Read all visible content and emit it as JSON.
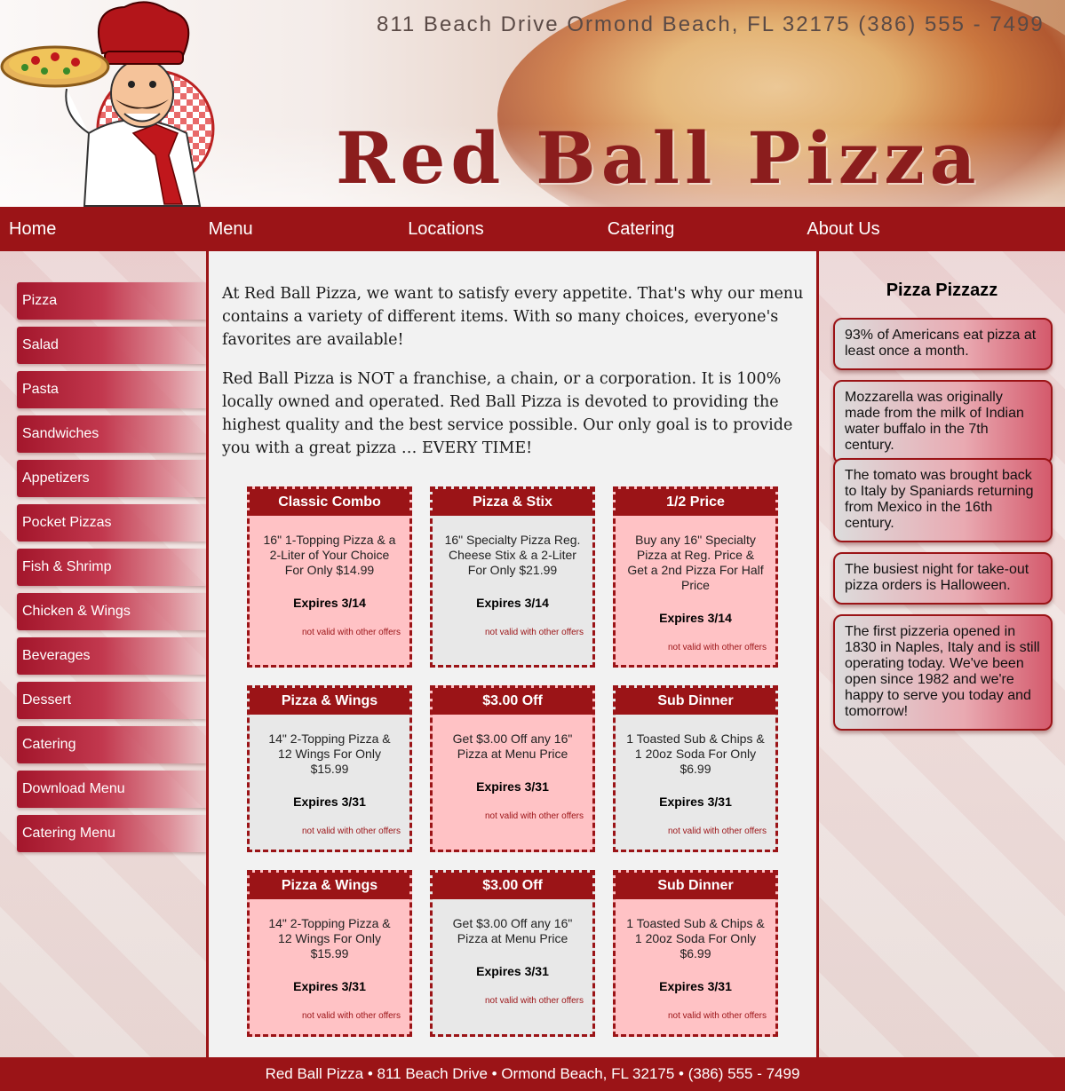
{
  "header": {
    "address_line": "811 Beach Drive  Ormond Beach, FL  32175   (386) 555 - 7499",
    "brand": "Red Ball Pizza"
  },
  "nav": [
    "Home",
    "Menu",
    "Locations",
    "Catering",
    "About Us"
  ],
  "sidebar": [
    "Pizza",
    "Salad",
    "Pasta",
    "Sandwiches",
    "Appetizers",
    "Pocket Pizzas",
    "Fish & Shrimp",
    "Chicken & Wings",
    "Beverages",
    "Dessert",
    "Catering",
    "Download Menu",
    "Catering Menu"
  ],
  "intro": [
    "At Red Ball Pizza, we want to satisfy every appetite. That's why our menu contains a variety of different items. With so many choices, everyone's favorites are available!",
    "Red Ball Pizza is NOT a franchise, a chain, or a corporation. It is 100% locally owned and operated. Red Ball Pizza is devoted to providing the highest quality and the best service possible. Our only goal is to provide you with a great pizza … EVERY TIME!"
  ],
  "coupons": [
    {
      "title": "Classic Combo",
      "desc": "16\" 1-Topping Pizza & a 2-Liter of Your Choice For Only $14.99",
      "expires": "Expires 3/14",
      "note": "not valid with other offers"
    },
    {
      "title": "Pizza & Stix",
      "desc": "16\" Specialty Pizza Reg. Cheese Stix & a 2-Liter For Only $21.99",
      "expires": "Expires 3/14",
      "note": "not valid with other offers"
    },
    {
      "title": "1/2 Price",
      "desc": "Buy any 16\" Specialty Pizza at Reg. Price & Get a 2nd Pizza For Half Price",
      "expires": "Expires 3/14",
      "note": "not valid with other offers"
    },
    {
      "title": "Pizza & Wings",
      "desc": "14\" 2-Topping Pizza & 12 Wings For Only $15.99",
      "expires": "Expires 3/31",
      "note": "not valid with other offers"
    },
    {
      "title": "$3.00 Off",
      "desc": "Get $3.00 Off any 16\" Pizza at Menu Price",
      "expires": "Expires 3/31",
      "note": "not valid with other offers"
    },
    {
      "title": "Sub Dinner",
      "desc": "1 Toasted Sub & Chips & 1 20oz Soda For Only $6.99",
      "expires": "Expires 3/31",
      "note": "not valid with other offers"
    },
    {
      "title": "Pizza & Wings",
      "desc": "14\" 2-Topping Pizza & 12 Wings For Only $15.99",
      "expires": "Expires 3/31",
      "note": "not valid with other offers"
    },
    {
      "title": "$3.00 Off",
      "desc": "Get $3.00 Off any 16\" Pizza at Menu Price",
      "expires": "Expires 3/31",
      "note": "not valid with other offers"
    },
    {
      "title": "Sub Dinner",
      "desc": "1 Toasted Sub & Chips & 1 20oz Soda For Only $6.99",
      "expires": "Expires 3/31",
      "note": "not valid with other offers"
    }
  ],
  "pizzazz": {
    "title": "Pizza Pizzazz",
    "facts": [
      "93% of Americans eat pizza at least once a month.",
      "Mozzarella was originally made from the milk of Indian water buffalo in the 7th century.",
      "The tomato was brought back to Italy by Spaniards returning from Mexico in the 16th century.",
      "The busiest night for take-out pizza orders is Halloween.",
      "The first pizzeria opened in 1830 in Naples, Italy and is still operating today. We've been open since 1982 and we're happy to serve you today and tomorrow!"
    ]
  },
  "footer": "Red Ball Pizza • 811 Beach Drive • Ormond Beach, FL 32175 • (386) 555 - 7499",
  "colors": {
    "brand_red": "#9b1417",
    "coupon_pink": "#ffc2c5",
    "coupon_gray": "#e8e8e8"
  }
}
